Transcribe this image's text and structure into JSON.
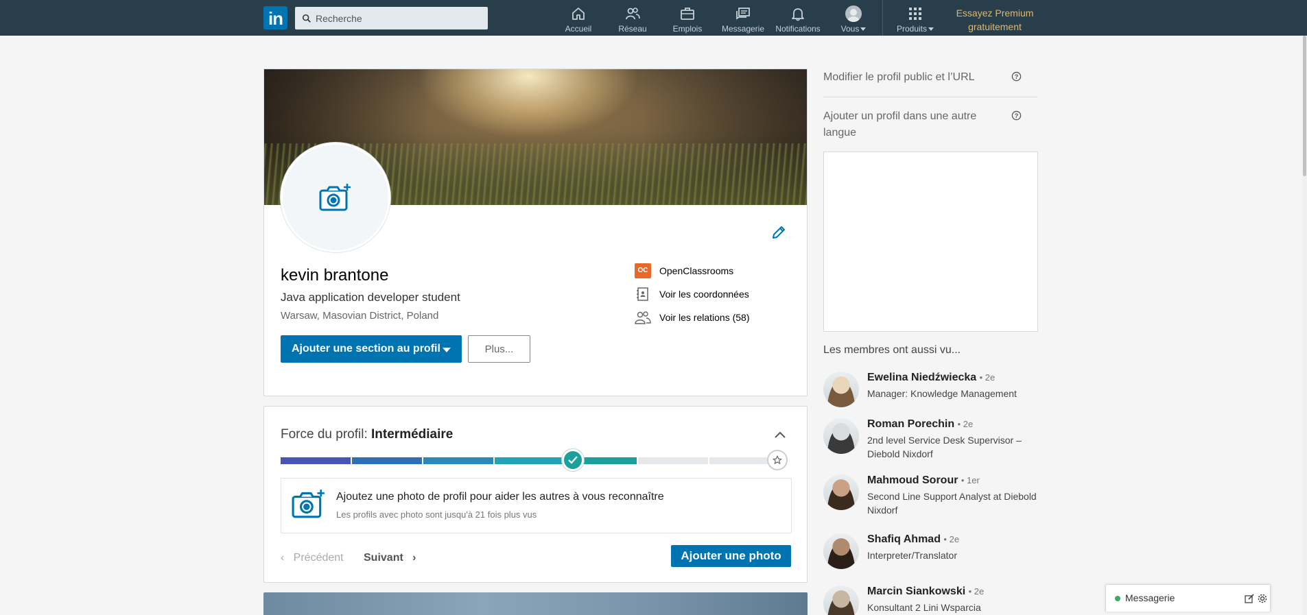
{
  "nav": {
    "logo": "in",
    "search_placeholder": "Recherche",
    "items": [
      {
        "label": "Accueil",
        "icon": "home-icon"
      },
      {
        "label": "Réseau",
        "icon": "network-icon"
      },
      {
        "label": "Emplois",
        "icon": "briefcase-icon"
      },
      {
        "label": "Messagerie",
        "icon": "messages-icon"
      },
      {
        "label": "Notifications",
        "icon": "bell-icon"
      },
      {
        "label": "Vous",
        "icon": "avatar"
      },
      {
        "label": "Produits",
        "icon": "grid-icon"
      }
    ],
    "premium": {
      "line1": "Essayez Premium",
      "line2": "gratuitement"
    }
  },
  "profile": {
    "name": "kevin brantone",
    "headline": "Java application developer student",
    "location": "Warsaw, Masovian District, Poland",
    "add_section_label": "Ajouter une section au profil",
    "more_label": "Plus...",
    "education": "OpenClassrooms",
    "education_logo": "OC",
    "contact_label": "Voir les coordonnées",
    "connections_label": "Voir les relations (58)"
  },
  "strength": {
    "title_prefix": "Force du profil:",
    "level": "Intermédiaire",
    "progress": 0.6,
    "suggestion_title": "Ajoutez une photo de profil pour aider les autres à vous reconnaître",
    "suggestion_sub": "Les profils avec photo sont jusqu'à 21 fois plus vus",
    "prev_label": "Précédent",
    "next_label": "Suivant",
    "add_photo_label": "Ajouter une photo"
  },
  "rail": {
    "public_profile": "Modifier le profil public et l’URL",
    "other_language": "Ajouter un profil dans une autre langue",
    "also_viewed_title": "Les membres ont aussi vu...",
    "members": [
      {
        "name": "Ewelina Niedźwiecka",
        "degree": "• 2e",
        "title": "Manager: Knowledge Management"
      },
      {
        "name": "Roman Porechin",
        "degree": "• 2e",
        "title": "2nd level Service Desk Supervisor – Diebold Nixdorf"
      },
      {
        "name": "Mahmoud Sorour",
        "degree": "• 1er",
        "title": "Second Line Support Analyst at Diebold Nixdorf"
      },
      {
        "name": "Shafiq Ahmad",
        "degree": "• 2e",
        "title": "Interpreter/Translator"
      },
      {
        "name": "Marcin Siankowski",
        "degree": "• 2e",
        "title": "Konsultant 2 Lini Wsparcia"
      }
    ]
  },
  "messaging": {
    "label": "Messagerie"
  },
  "colors": {
    "nav_bg": "#283e4a",
    "primary": "#0073b1",
    "premium": "#e3b76a"
  }
}
